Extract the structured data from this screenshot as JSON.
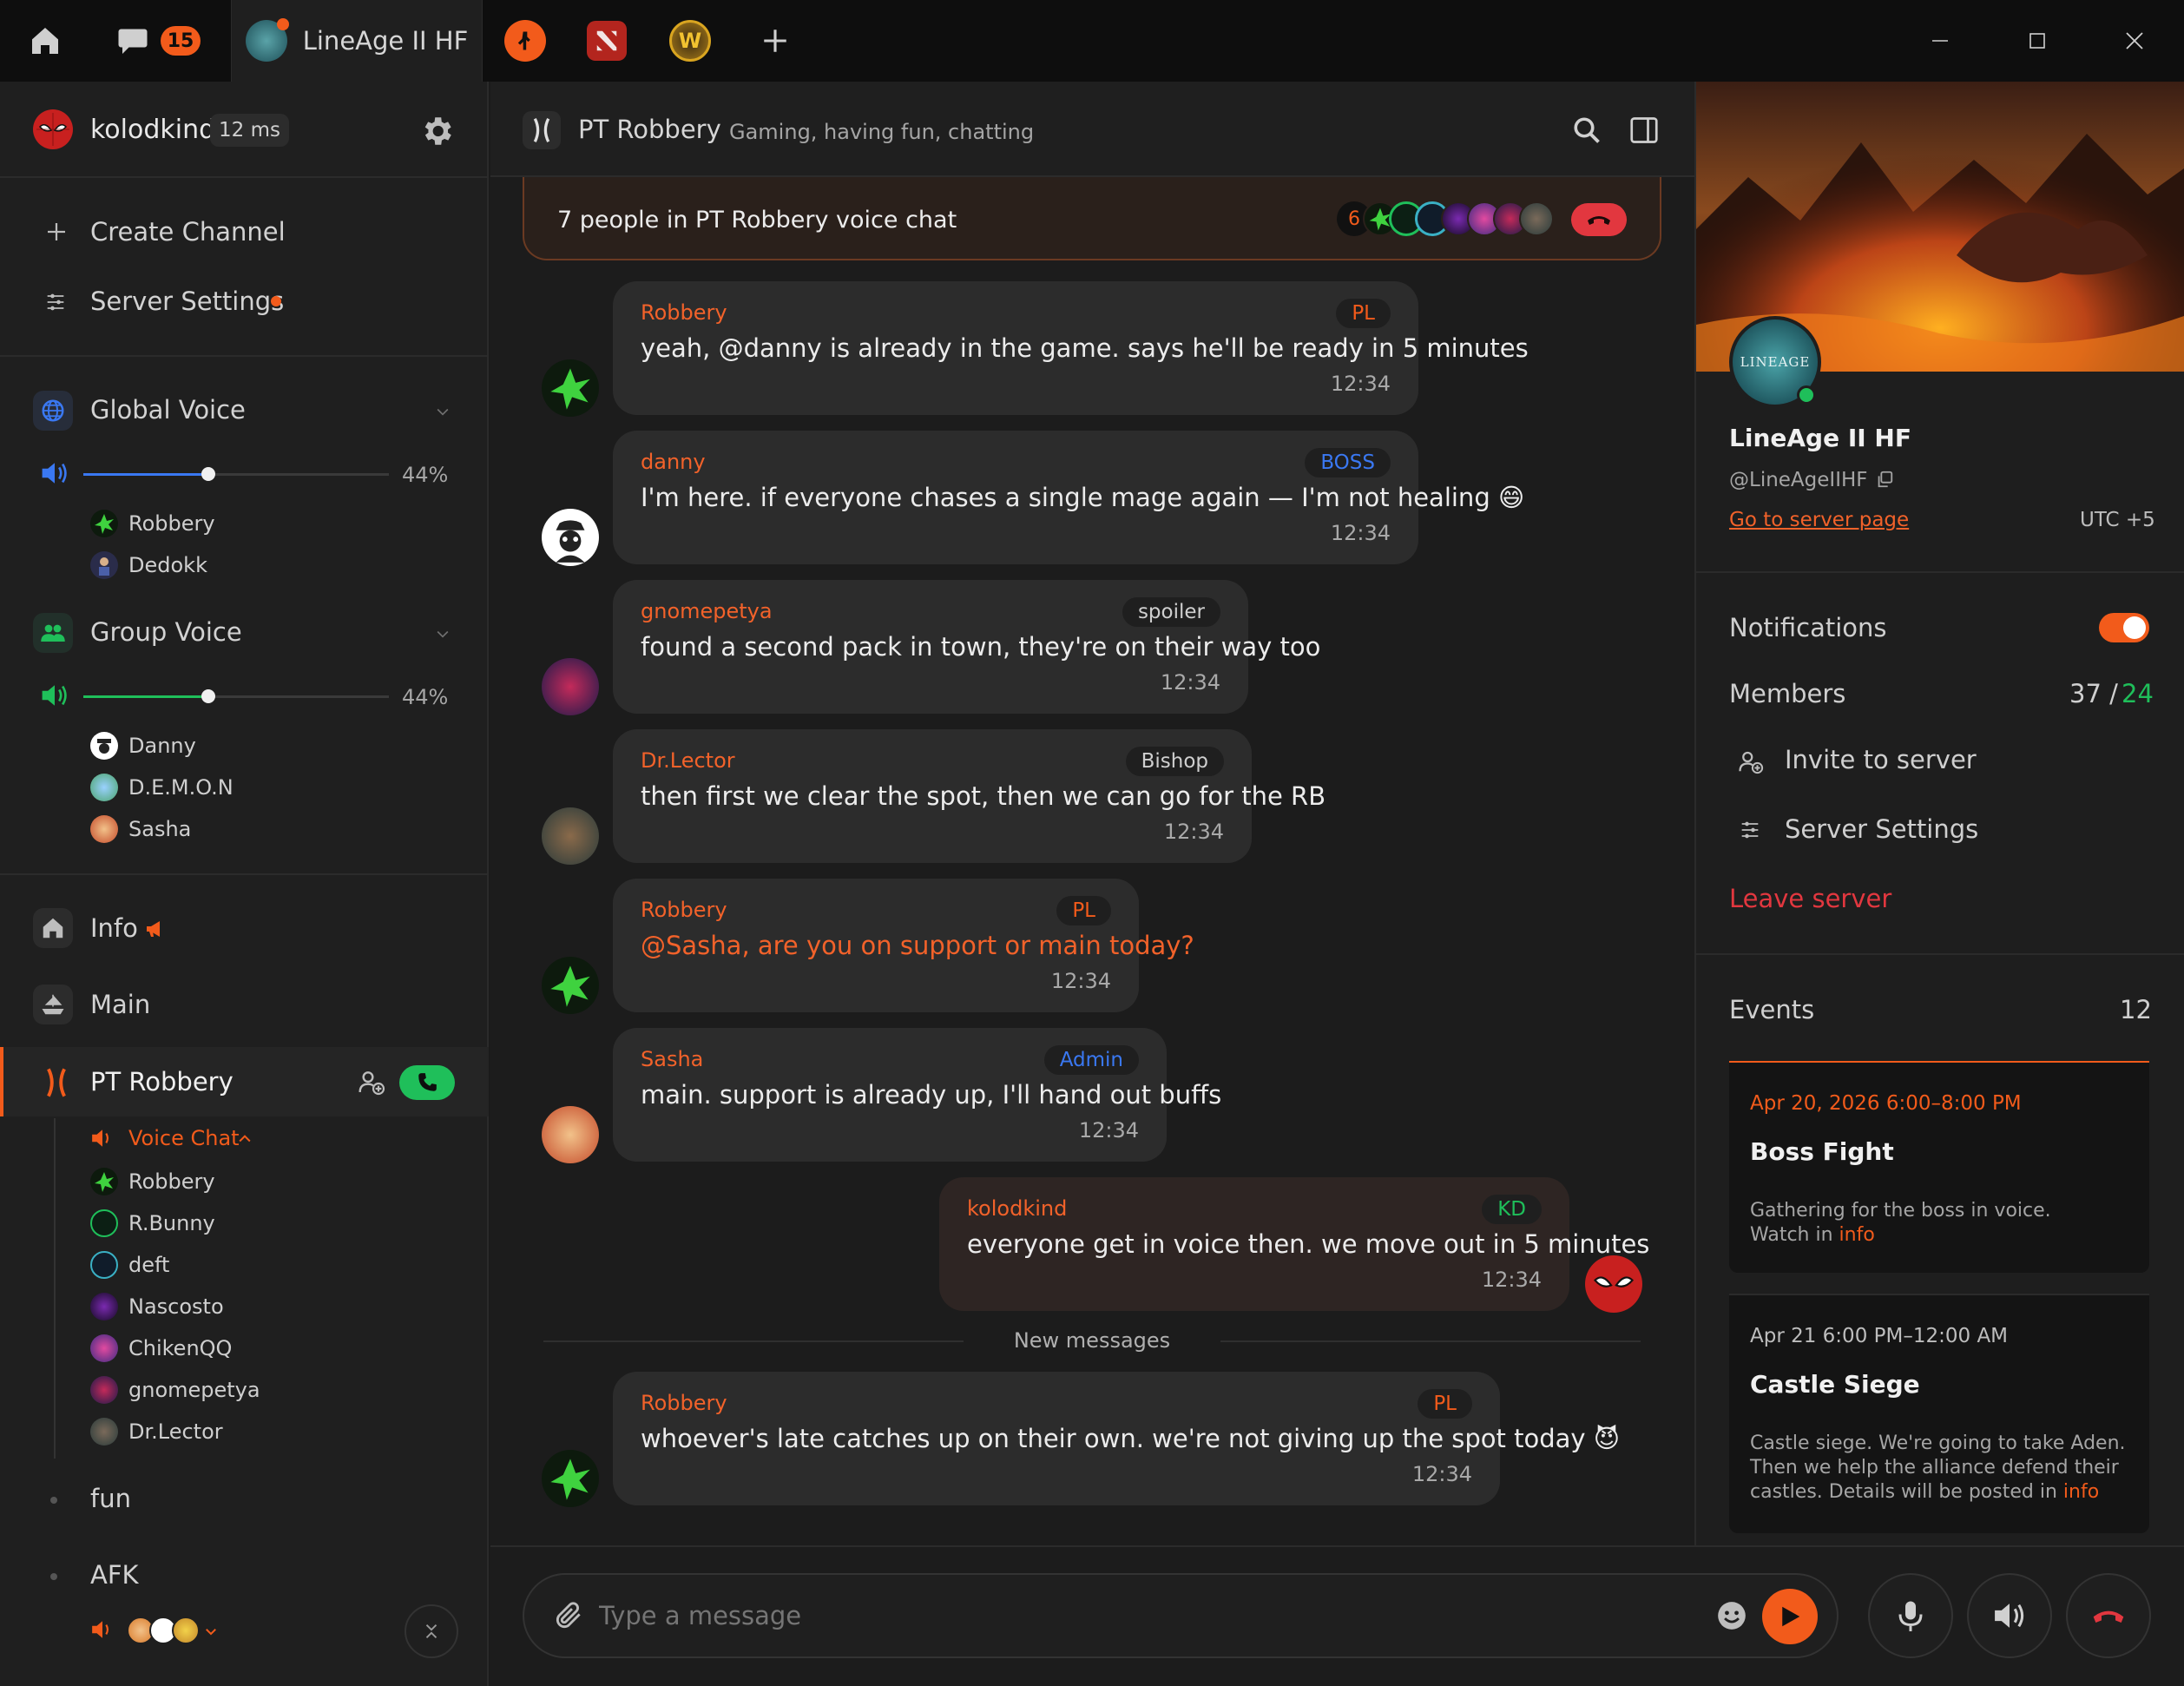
{
  "titlebar": {
    "chat_badge": "15",
    "active_tab_title": "LineAge II HF",
    "tab_icons": [
      "counter-strike-icon",
      "dota-icon",
      "warcraft-icon"
    ],
    "window_controls": [
      "minimize",
      "maximize",
      "close"
    ]
  },
  "user": {
    "name": "kolodkind",
    "ping": "12 ms"
  },
  "sidebar": {
    "actions": {
      "create_channel": "Create Channel",
      "server_settings": "Server Settings"
    },
    "global_voice": {
      "label": "Global Voice",
      "volume": "44%",
      "members": [
        "Robbery",
        "Dedokk"
      ]
    },
    "group_voice": {
      "label": "Group Voice",
      "volume": "44%",
      "members": [
        "Danny",
        "D.E.M.O.N",
        "Sasha"
      ]
    },
    "channels": {
      "info": "Info",
      "main": "Main",
      "pt_robbery": "PT Robbery"
    },
    "voice_chat": {
      "label": "Voice Chat",
      "members": [
        "Robbery",
        "R.Bunny",
        "deft",
        "Nascosto",
        "ChikenQQ",
        "gnomepetya",
        "Dr.Lector"
      ]
    },
    "more_channels": [
      "fun",
      "AFK"
    ]
  },
  "chat": {
    "title": "PT Robbery",
    "subtitle": "Gaming, having fun, chatting",
    "voice_banner": {
      "text": "7 people in PT Robbery voice chat",
      "count": "6"
    },
    "new_messages_label": "New messages",
    "messages": [
      {
        "author": "Robbery",
        "tag": "PL",
        "text": "yeah, @danny is already in the game. says he'll be ready in 5 minutes",
        "time": "12:34"
      },
      {
        "author": "danny",
        "tag": "BOSS",
        "text": "I'm here. if everyone chases a single mage again — I'm not healing 😄",
        "time": "12:34"
      },
      {
        "author": "gnomepetya",
        "tag": "spoiler",
        "text": "found a second pack in town, they're on their way too",
        "time": "12:34"
      },
      {
        "author": "Dr.Lector",
        "tag": "Bishop",
        "text": "then first we clear the spot, then we can go for the RB",
        "time": "12:34"
      },
      {
        "author": "Robbery",
        "tag": "PL",
        "text": "@Sasha, are you on support or main today?",
        "time": "12:34"
      },
      {
        "author": "Sasha",
        "tag": "Admin",
        "text": "main. support is already up, I'll hand out buffs",
        "time": "12:34"
      },
      {
        "author": "kolodkind",
        "tag": "KD",
        "text": "everyone get in voice then. we move out in 5 minutes",
        "time": "12:34"
      },
      {
        "author": "Robbery",
        "tag": "PL",
        "text": "whoever's late catches up on their own. we're not giving up the spot today 😈",
        "time": "12:34"
      }
    ],
    "composer_placeholder": "Type a message"
  },
  "server": {
    "name": "LineAge II HF",
    "handle": "@LineAgeIIHF",
    "server_link": "Go to server page",
    "timezone": "UTC +5",
    "logo_text": "LINEAGE",
    "notifications_label": "Notifications",
    "notifications_on": true,
    "members_label": "Members",
    "members_total": "37 /",
    "members_online": "24",
    "invite": "Invite to server",
    "settings": "Server Settings",
    "leave": "Leave server",
    "events_label": "Events",
    "events_count": "12",
    "events": [
      {
        "date": "Apr 20, 2026 6:00–8:00 PM",
        "title": "Boss Fight",
        "desc": "Gathering for the boss in voice.",
        "desc2_prefix": "Watch in",
        "link": "info"
      },
      {
        "date": "Apr 21 6:00 PM–12:00 AM",
        "title": "Castle Siege",
        "desc": "Castle siege. We're going to take Aden.",
        "desc2": "Then we help the alliance defend their",
        "desc3_prefix": "castles. Details will be posted in",
        "link": "info"
      }
    ]
  },
  "colors": {
    "accent": "#f25b1b",
    "green": "#1fbf5a",
    "blue": "#3a78f2",
    "danger": "#e2373f"
  }
}
